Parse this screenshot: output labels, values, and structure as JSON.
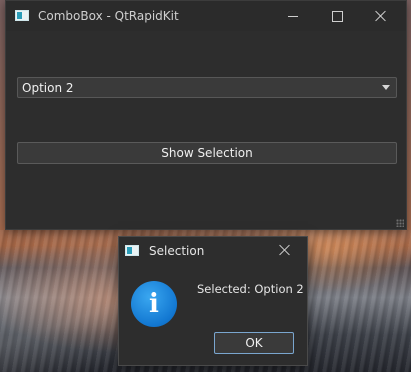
{
  "main_window": {
    "title": "ComboBox - QtRapidKit",
    "combo": {
      "selected": "Option 2"
    },
    "show_button_label": "Show Selection"
  },
  "dialog": {
    "title": "Selection",
    "message": "Selected: Option 2",
    "ok_label": "OK",
    "icon": "info-icon"
  },
  "icons": [
    "app-icon",
    "minimize-icon",
    "maximize-icon",
    "close-icon",
    "chevron-down-icon",
    "info-icon"
  ],
  "colors": {
    "info_blue": "#1277d1",
    "ok_focus_border": "#7aa6cf",
    "window_bg": "#2d2d2d"
  }
}
